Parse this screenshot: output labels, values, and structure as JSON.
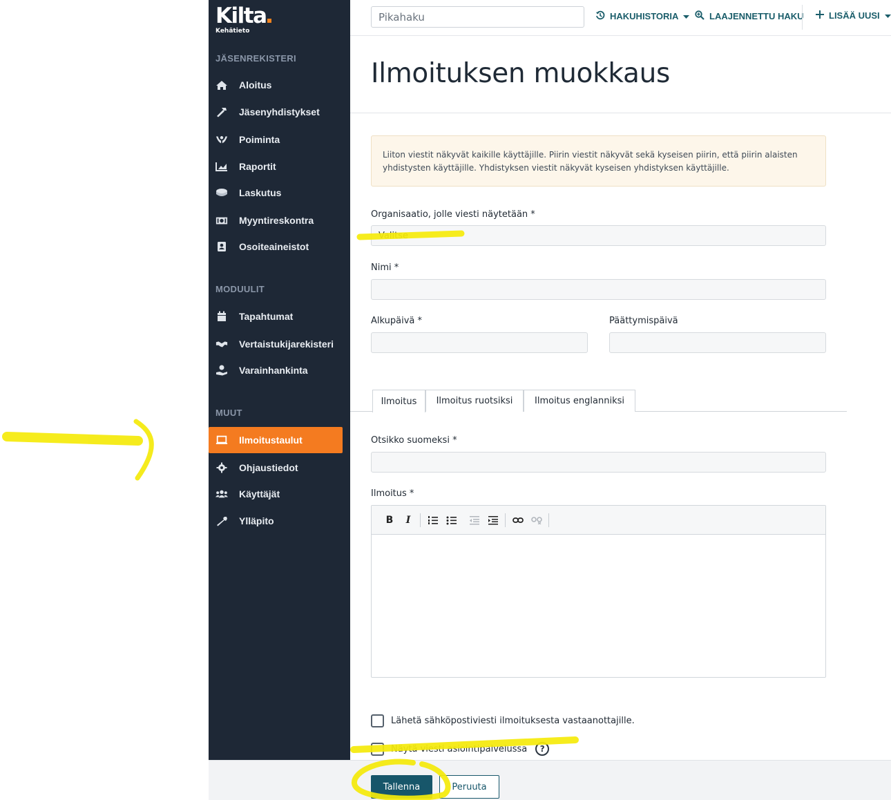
{
  "logo": {
    "name": "Kilta",
    "sub": "Kehätieto"
  },
  "sidebar": {
    "section_main": "JÄSENREKISTERI",
    "main_items": [
      {
        "label": "Aloitus",
        "icon": "home-icon"
      },
      {
        "label": "Jäsenyhdistykset",
        "icon": "hammer-icon"
      },
      {
        "label": "Poiminta",
        "icon": "hands-icon"
      },
      {
        "label": "Raportit",
        "icon": "chart-icon"
      },
      {
        "label": "Laskutus",
        "icon": "coins-icon"
      },
      {
        "label": "Myyntireskontra",
        "icon": "money-icon"
      },
      {
        "label": "Osoiteaineistot",
        "icon": "address-book-icon"
      }
    ],
    "section_modules": "MODUULIT",
    "module_items": [
      {
        "label": "Tapahtumat",
        "icon": "calendar-icon"
      },
      {
        "label": "Vertaistukijarekisteri",
        "icon": "handshake-icon"
      },
      {
        "label": "Varainhankinta",
        "icon": "donate-icon"
      }
    ],
    "section_other": "MUUT",
    "other_items": [
      {
        "label": "Ilmoitustaulut",
        "icon": "laptop-icon",
        "active": true
      },
      {
        "label": "Ohjaustiedot",
        "icon": "gear-icon"
      },
      {
        "label": "Käyttäjät",
        "icon": "users-icon"
      },
      {
        "label": "Ylläpito",
        "icon": "wrench-icon"
      }
    ]
  },
  "topbar": {
    "search_placeholder": "Pikahaku",
    "history": "HAKUHISTORIA",
    "advanced": "LAAJENNETTU HAKU",
    "add_new": "LISÄÄ UUSI"
  },
  "page": {
    "title": "Ilmoituksen muokkaus",
    "alert": "Liiton viestit näkyvät kaikille käyttäjille. Piirin viestit näkyvät sekä kyseisen piirin, että piirin alaisten yhdistysten käyttäjille. Yhdistyksen viestit näkyvät kyseisen yhdistyksen käyttäjille."
  },
  "form": {
    "org_label": "Organisaatio, jolle viesti näytetään *",
    "org_value": "Valitse",
    "name_label": "Nimi *",
    "start_label": "Alkupäivä *",
    "end_label": "Päättymispäivä",
    "tabs": [
      "Ilmoitus",
      "Ilmoitus ruotsiksi",
      "Ilmoitus englanniksi"
    ],
    "title_label": "Otsikko suomeksi *",
    "body_label": "Ilmoitus *",
    "toolbar": {
      "bold": "B",
      "italic": "I"
    },
    "check_email": "Lähetä sähköpostiviesti ilmoituksesta vastaanottajille.",
    "check_show": "Näytä viesti asiointipalvelussa",
    "help": "?"
  },
  "footer": {
    "save": "Tallenna",
    "cancel": "Peruuta"
  },
  "colors": {
    "sidebar": "#1e2836",
    "active": "#f47b20",
    "primary": "#17566a",
    "highlight": "#f5ea0a"
  }
}
